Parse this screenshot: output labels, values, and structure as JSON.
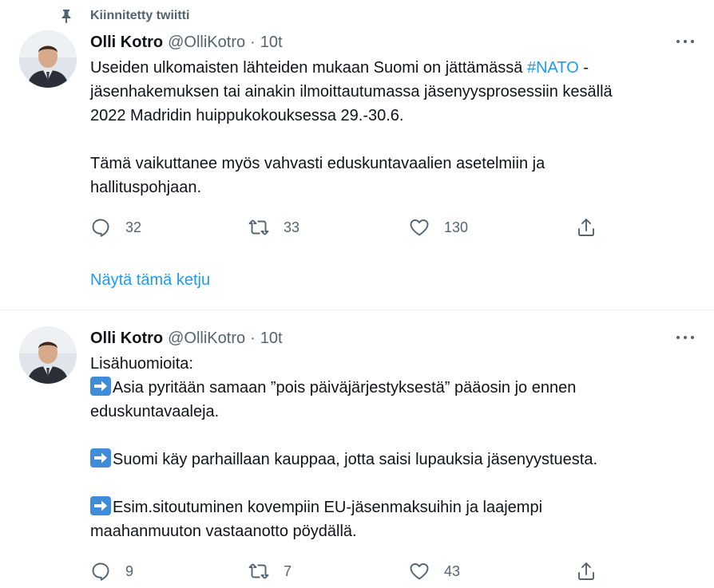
{
  "pinned": {
    "label": "Kiinnitetty twiitti",
    "icon": "pin-icon"
  },
  "tweets": [
    {
      "author_name": "Olli Kotro",
      "handle": "@OlliKotro",
      "separator": "·",
      "time": "10t",
      "text": {
        "line1_pre": "Useiden ulkomaisten lähteiden mukaan Suomi on jättämässä ",
        "hashtag": "#NATO",
        "line1_post": " -\njäsenhakemuksen tai ainakin ilmoittautumassa jäsenyysprosessiin kesällä\n2022 Madridin huippukokouksessa 29.-30.6.",
        "para2": "Tämä vaikuttanee myös vahvasti eduskuntavaalien asetelmiin ja\nhallituspohjaan."
      },
      "replies": "32",
      "retweets": "33",
      "likes": "130",
      "show_thread": "Näytä tämä ketju"
    },
    {
      "author_name": "Olli Kotro",
      "handle": "@OlliKotro",
      "separator": "·",
      "time": "10t",
      "text": {
        "intro": "Lisähuomioita:",
        "point1": "Asia pyritään samaan ”pois päiväjärjestyksestä” pääosin jo ennen\neduskuntavaaleja.",
        "point2": "Suomi käy parhaillaan kauppaa, jotta saisi lupauksia jäsenyystuesta.",
        "point3": "Esim.sitoutuminen kovempiin EU-jäsenmaksuihin ja laajempi\nmaahanmuuton vastaanotto pöydällä."
      },
      "replies": "9",
      "retweets": "7",
      "likes": "43"
    }
  ],
  "colors": {
    "accent": "#1d9bf0",
    "secondary_text": "#536471",
    "text": "#0f1419",
    "divider": "#eff3f4"
  }
}
